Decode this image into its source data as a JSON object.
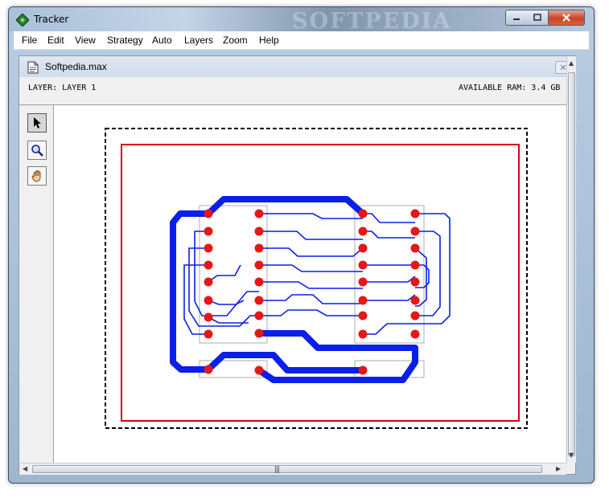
{
  "window": {
    "title": "Tracker",
    "watermark": "SOFTPEDIA"
  },
  "menu": {
    "items": [
      "File",
      "Edit",
      "View",
      "Strategy",
      "Auto",
      "Layers",
      "Zoom",
      "Help"
    ]
  },
  "document": {
    "name": "Softpedia.max",
    "close_glyph": "✕"
  },
  "status": {
    "layer": "LAYER: LAYER 1",
    "ram": "AVAILABLE RAM: 3.4 GB"
  },
  "tools": [
    {
      "icon": "arrow-pointer-icon",
      "active": true
    },
    {
      "icon": "magnifier-icon",
      "active": false
    },
    {
      "icon": "hand-pan-icon",
      "active": false
    }
  ],
  "colors": {
    "trace": "#0a1fe8",
    "pad": "#e51717",
    "board_outline": "#d4001a",
    "selection": "#000000"
  }
}
